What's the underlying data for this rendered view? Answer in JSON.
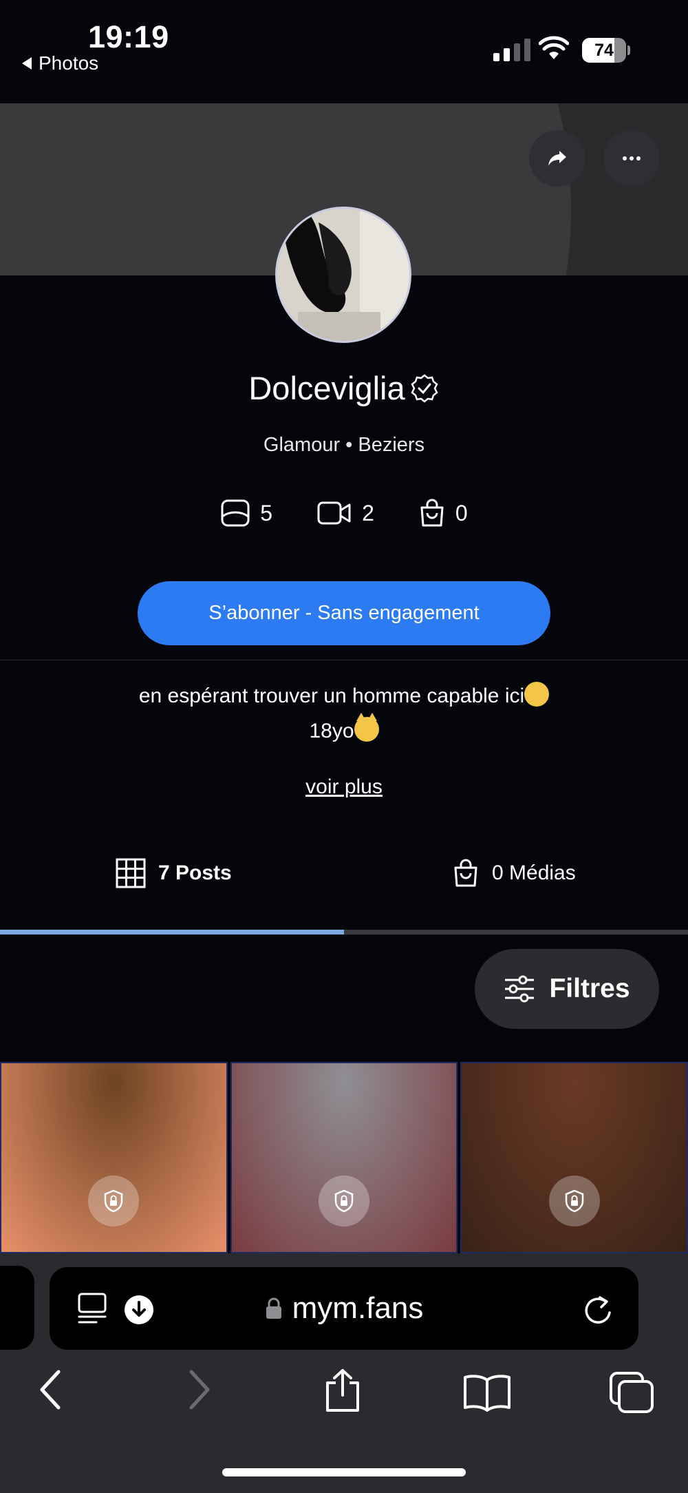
{
  "status_bar": {
    "time": "19:19",
    "back_app_label": "Photos",
    "battery_percent": "74",
    "battery_level": 0.74,
    "signal_bars_active": 2
  },
  "profile": {
    "name": "Dolceviglia",
    "verified": true,
    "subtitle": "Glamour • Beziers",
    "stats": {
      "photos": "5",
      "videos": "2",
      "shop": "0"
    },
    "subscribe_label": "S’abonner - Sans engagement",
    "bio_line1": "en espérant trouver un homme capable ici",
    "bio_line2": "18yo",
    "see_more_label": "voir plus"
  },
  "tabs": [
    {
      "label": "7 Posts",
      "active": true
    },
    {
      "label": "0 Médias",
      "active": false
    }
  ],
  "filter_label": "Filtres",
  "posts": [
    {
      "locked": true,
      "colors": [
        "#6d4322",
        "#e7906a"
      ]
    },
    {
      "locked": true,
      "colors": [
        "#8f8f94",
        "#7a3b3f"
      ]
    },
    {
      "locked": true,
      "colors": [
        "#6a3a22",
        "#3a2218"
      ]
    }
  ],
  "browser": {
    "url": "mym.fans"
  },
  "colors": {
    "accent": "#2c7bf2",
    "background": "#05060b",
    "tab_indicator": "#7fa9e6"
  }
}
